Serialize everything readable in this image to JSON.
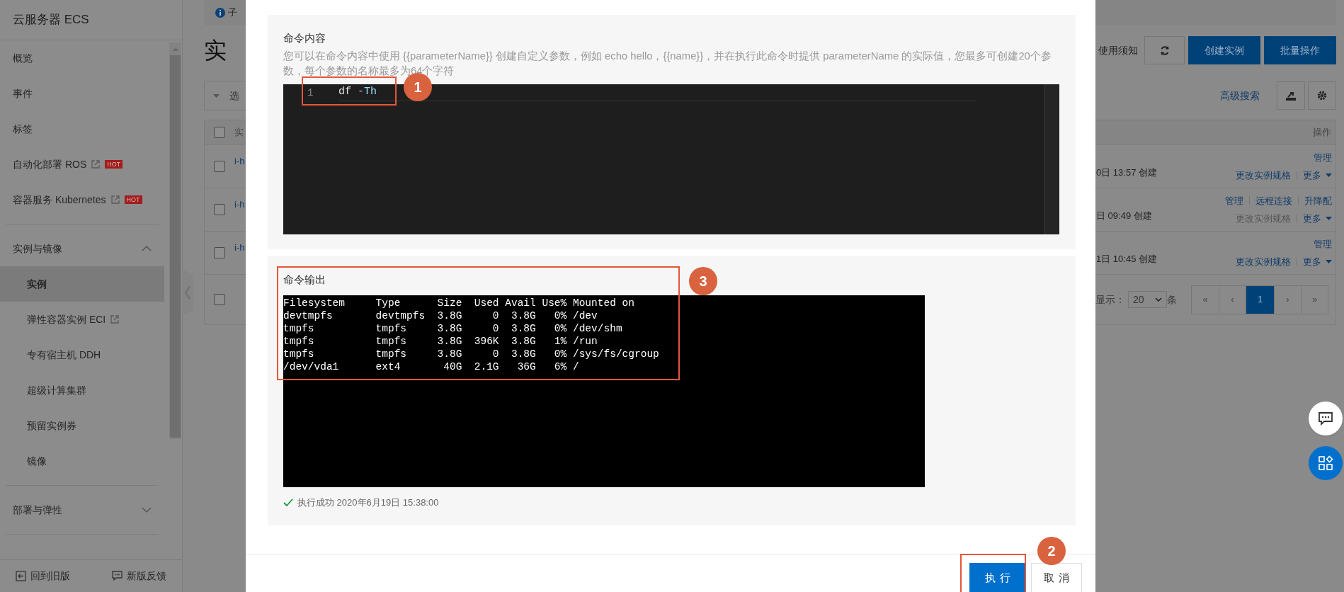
{
  "sidebar": {
    "title": "云服务器 ECS",
    "items": [
      {
        "kind": "link",
        "label": "概览",
        "external": false
      },
      {
        "kind": "link",
        "label": "事件",
        "external": false
      },
      {
        "kind": "link",
        "label": "标签",
        "external": false
      },
      {
        "kind": "link",
        "label": "自动化部署 ROS",
        "external": true,
        "badge": "HOT"
      },
      {
        "kind": "link",
        "label": "容器服务 Kubernetes",
        "external": true,
        "badge": "HOT"
      },
      {
        "kind": "group",
        "label": "实例与镜像",
        "expanded": true,
        "children": [
          {
            "label": "实例",
            "selected": true,
            "external": false
          },
          {
            "label": "弹性容器实例 ECI",
            "selected": false,
            "external": true
          },
          {
            "label": "专有宿主机 DDH",
            "selected": false,
            "external": false
          },
          {
            "label": "超级计算集群",
            "selected": false,
            "external": false
          },
          {
            "label": "预留实例券",
            "selected": false,
            "external": false
          },
          {
            "label": "镜像",
            "selected": false,
            "external": false
          }
        ]
      },
      {
        "kind": "group",
        "label": "部署与弹性",
        "expanded": false
      }
    ],
    "footer": [
      {
        "kind": "back",
        "label": "回到旧版"
      },
      {
        "kind": "feedback",
        "label": "新版反馈"
      }
    ]
  },
  "page": {
    "notice": "子",
    "title": "实",
    "notice_link": "使用须知",
    "buttons": [
      "创建实例",
      "批量操作"
    ],
    "filter": "选",
    "advanced_search": "高级搜索",
    "table": {
      "columns": [
        "实",
        "操作"
      ],
      "header_checked": false,
      "rows": [
        {
          "checked": false,
          "instance": "i-h",
          "created": "0日 13:57 创建",
          "action_lines": [
            [
              {
                "label": "管理",
                "disabled": false,
                "menu": false
              }
            ],
            [
              {
                "label": "更改实例规格",
                "disabled": false,
                "menu": false
              },
              {
                "label": "更多",
                "disabled": false,
                "menu": true
              }
            ]
          ]
        },
        {
          "checked": false,
          "instance": "i-h",
          "created": "日 09:49 创建",
          "action_lines": [
            [
              {
                "label": "管理",
                "disabled": false,
                "menu": false
              },
              {
                "label": "远程连接",
                "disabled": false,
                "menu": false
              },
              {
                "label": "升降配",
                "disabled": false,
                "menu": false
              }
            ],
            [
              {
                "label": "更改实例规格",
                "disabled": true,
                "menu": false
              },
              {
                "label": "更多",
                "disabled": false,
                "menu": true
              }
            ]
          ]
        },
        {
          "checked": false,
          "instance": "i-h",
          "created": "1日 10:45 创建",
          "action_lines": [
            [
              {
                "label": "管理",
                "disabled": false,
                "menu": false
              }
            ],
            [
              {
                "label": "更改实例规格",
                "disabled": false,
                "menu": false
              },
              {
                "label": "更多",
                "disabled": false,
                "menu": true
              }
            ]
          ]
        }
      ]
    },
    "pagination": {
      "checked": false,
      "page_size_label": "显示：",
      "page_size": "20",
      "unit": "条",
      "pages": [
        {
          "label": "«",
          "selected": false
        },
        {
          "label": "‹",
          "selected": false
        },
        {
          "label": "1",
          "selected": true
        },
        {
          "label": "›",
          "selected": false
        },
        {
          "label": "»",
          "selected": false
        }
      ]
    }
  },
  "dialog": {
    "content": {
      "title": "命令内容",
      "description": "您可以在命令内容中使用 {{parameterName}} 创建自定义参数，例如 echo hello，{{name}}，并在执行此命令时提供 parameterName 的实际值，您最多可创建20个参数，每个参数的名称最多为64个字符",
      "callout": "1",
      "lines": [
        {
          "number": "1",
          "tokens": [
            {
              "kind": "command",
              "text": "df"
            },
            {
              "kind": "option",
              "text": "-Th"
            }
          ]
        }
      ]
    },
    "output": {
      "title": "命令输出",
      "callout": "3",
      "lines": [
        "Filesystem     Type      Size  Used Avail Use% Mounted on",
        "devtmpfs       devtmpfs  3.8G     0  3.8G   0% /dev",
        "tmpfs          tmpfs     3.8G     0  3.8G   0% /dev/shm",
        "tmpfs          tmpfs     3.8G  396K  3.8G   1% /run",
        "tmpfs          tmpfs     3.8G     0  3.8G   0% /sys/fs/cgroup",
        "/dev/vda1      ext4       40G  2.1G   36G   6% /"
      ],
      "status": {
        "success": true,
        "text": "执行成功 2020年6月19日 15:38:00"
      }
    },
    "callout": "2",
    "buttons": [
      {
        "kind": "primary",
        "label": "执行"
      },
      {
        "kind": "secondary",
        "label": "取消"
      }
    ]
  }
}
